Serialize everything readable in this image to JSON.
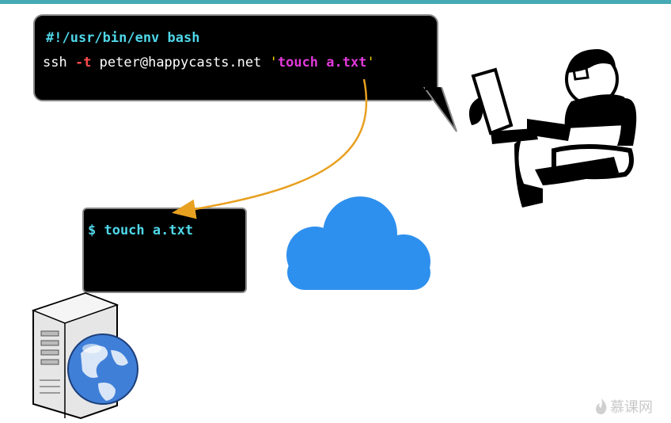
{
  "script": {
    "shebang": "#!/usr/bin/env bash",
    "cmd_ssh": "ssh ",
    "flag": "-t",
    "host": " peter@happycasts.net ",
    "quote_open": "'",
    "remote_cmd": "touch a.txt",
    "quote_close": "'"
  },
  "remote_terminal": {
    "prompt_line": "$ touch a.txt"
  },
  "watermark": {
    "text": "慕课网"
  },
  "colors": {
    "accent_bar": "#46aab4",
    "arrow": "#e8a020",
    "cloud": "#2e90ee",
    "prompt_text": "#4fd6e8"
  },
  "icons": [
    "computer-user-icon",
    "cloud-icon",
    "web-server-icon",
    "flame-logo-icon"
  ]
}
